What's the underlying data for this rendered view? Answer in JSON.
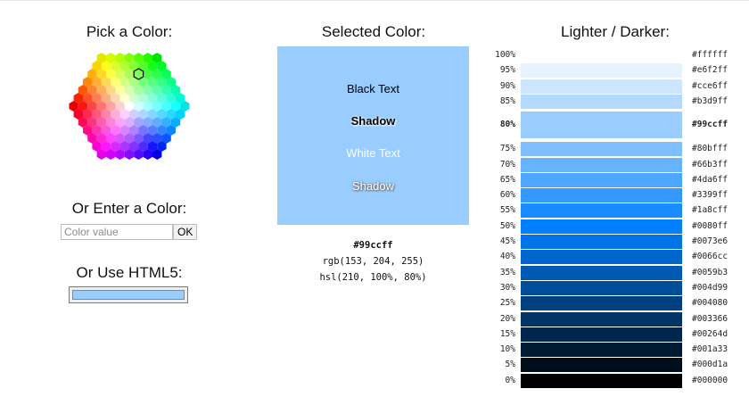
{
  "left": {
    "pick_title": "Pick a Color:",
    "enter_title": "Or Enter a Color:",
    "input_placeholder": "Color value",
    "ok_label": "OK",
    "html5_title": "Or Use HTML5:",
    "html5_value": "#99ccff"
  },
  "middle": {
    "title": "Selected Color:",
    "selected_hex": "#99ccff",
    "black_text": "Black Text",
    "shadow_text": "Shadow",
    "white_text": "White Text",
    "white_shadow_text": "Shadow",
    "hex_code": "#99ccff",
    "rgb_code": "rgb(153, 204, 255)",
    "hsl_code": "hsl(210, 100%, 80%)"
  },
  "right": {
    "title": "Lighter / Darker:",
    "shades": [
      {
        "pct": "100%",
        "hex": "#ffffff"
      },
      {
        "pct": "95%",
        "hex": "#e6f2ff"
      },
      {
        "pct": "90%",
        "hex": "#cce6ff"
      },
      {
        "pct": "85%",
        "hex": "#b3d9ff"
      },
      {
        "pct": "80%",
        "hex": "#99ccff",
        "selected": true
      },
      {
        "pct": "75%",
        "hex": "#80bfff"
      },
      {
        "pct": "70%",
        "hex": "#66b3ff"
      },
      {
        "pct": "65%",
        "hex": "#4da6ff"
      },
      {
        "pct": "60%",
        "hex": "#3399ff"
      },
      {
        "pct": "55%",
        "hex": "#1a8cff"
      },
      {
        "pct": "50%",
        "hex": "#0080ff"
      },
      {
        "pct": "45%",
        "hex": "#0073e6"
      },
      {
        "pct": "40%",
        "hex": "#0066cc"
      },
      {
        "pct": "35%",
        "hex": "#0059b3"
      },
      {
        "pct": "30%",
        "hex": "#004d99"
      },
      {
        "pct": "25%",
        "hex": "#004080"
      },
      {
        "pct": "20%",
        "hex": "#003366"
      },
      {
        "pct": "15%",
        "hex": "#00264d"
      },
      {
        "pct": "10%",
        "hex": "#001a33"
      },
      {
        "pct": "5%",
        "hex": "#000d1a"
      },
      {
        "pct": "0%",
        "hex": "#000000"
      }
    ]
  }
}
